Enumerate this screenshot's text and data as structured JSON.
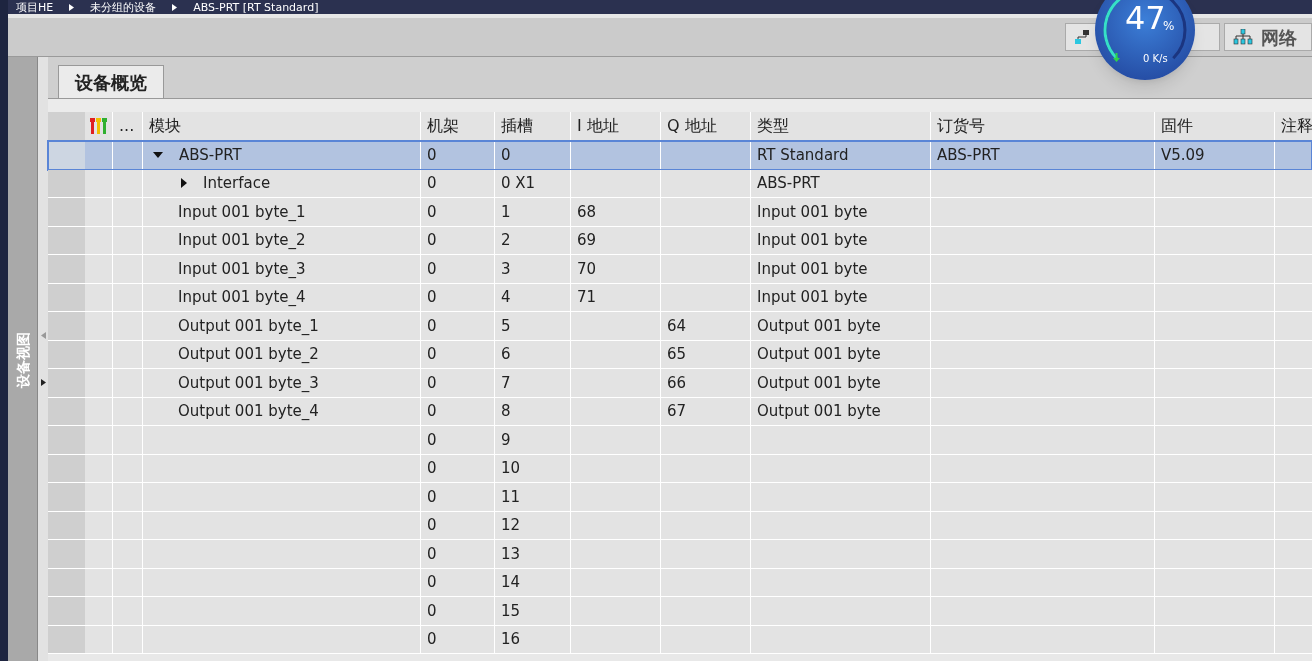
{
  "breadcrumb": [
    "项目HE",
    "未分组的设备",
    "ABS-PRT [RT Standard]"
  ],
  "toolbar": {
    "buttons": [
      {
        "kind": "topology"
      },
      {
        "kind": "network",
        "label": "网络"
      }
    ]
  },
  "speed_meter": {
    "percent": "47",
    "unit": "%",
    "rate": "0 K/s",
    "level": 0.47
  },
  "side_panel": {
    "title": "设备视图"
  },
  "tabs": [
    {
      "label": "设备概览",
      "selected": true
    }
  ],
  "table": {
    "columns": [
      "...",
      "模块",
      "机架",
      "插槽",
      "I 地址",
      "Q 地址",
      "类型",
      "订货号",
      "固件",
      "注释"
    ],
    "rows": [
      {
        "module": "ABS-PRT",
        "rack": "0",
        "slot": "0",
        "type": "RT Standard",
        "order": "ABS-PRT",
        "firmware": "V5.09",
        "expanded": true,
        "selected": true
      },
      {
        "module": "Interface",
        "rack": "0",
        "slot": "0 X1",
        "type": "ABS-PRT",
        "expanded": false,
        "selected": false
      },
      {
        "module": "Input 001 byte_1",
        "rack": "0",
        "slot": "1",
        "i": "68",
        "type": "Input 001 byte",
        "selected": false
      },
      {
        "module": "Input 001 byte_2",
        "rack": "0",
        "slot": "2",
        "i": "69",
        "type": "Input 001 byte",
        "selected": false
      },
      {
        "module": "Input 001 byte_3",
        "rack": "0",
        "slot": "3",
        "i": "70",
        "type": "Input 001 byte",
        "selected": false
      },
      {
        "module": "Input 001 byte_4",
        "rack": "0",
        "slot": "4",
        "i": "71",
        "type": "Input 001 byte",
        "selected": false
      },
      {
        "module": "Output 001 byte_1",
        "rack": "0",
        "slot": "5",
        "q": "64",
        "type": "Output 001 byte",
        "selected": false
      },
      {
        "module": "Output 001 byte_2",
        "rack": "0",
        "slot": "6",
        "q": "65",
        "type": "Output 001 byte",
        "selected": false
      },
      {
        "module": "Output 001 byte_3",
        "rack": "0",
        "slot": "7",
        "q": "66",
        "type": "Output 001 byte",
        "selected": false
      },
      {
        "module": "Output 001 byte_4",
        "rack": "0",
        "slot": "8",
        "q": "67",
        "type": "Output 001 byte",
        "selected": false
      },
      {
        "rack": "0",
        "slot": "9",
        "selected": false
      },
      {
        "rack": "0",
        "slot": "10",
        "selected": false
      },
      {
        "rack": "0",
        "slot": "11",
        "selected": false
      },
      {
        "rack": "0",
        "slot": "12",
        "selected": false
      },
      {
        "rack": "0",
        "slot": "13",
        "selected": false
      },
      {
        "rack": "0",
        "slot": "14",
        "selected": false
      },
      {
        "rack": "0",
        "slot": "15",
        "selected": false
      },
      {
        "rack": "0",
        "slot": "16",
        "selected": false
      }
    ]
  }
}
